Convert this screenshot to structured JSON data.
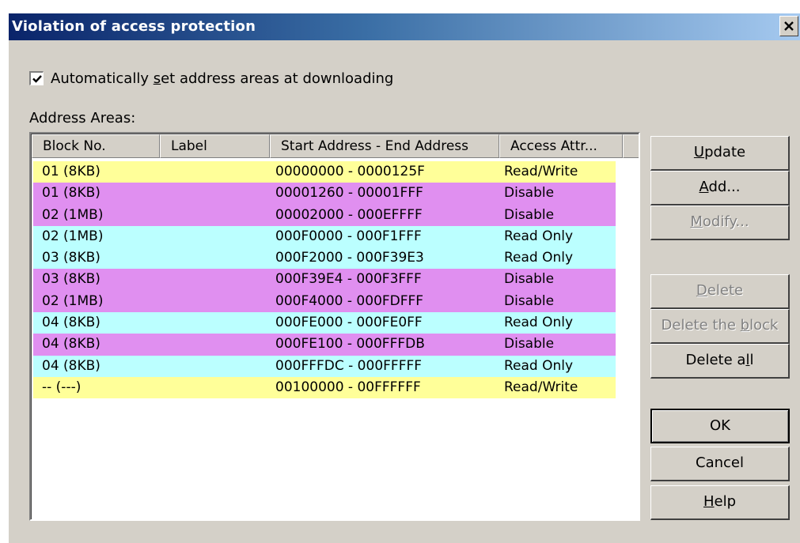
{
  "dialog": {
    "title": "Violation of access protection"
  },
  "auto_checkbox": {
    "checked": true,
    "label_pre": "Automatically ",
    "label_hot": "s",
    "label_post": "et address areas at downloading"
  },
  "section_label": "Address Areas:",
  "columns": [
    "Block No.",
    "Label",
    "Start Address - End Address",
    "Access Attr..."
  ],
  "colors": {
    "yellow": "#ffff99",
    "purple": "#e08ff0",
    "cyan": "#bbffff"
  },
  "rows": [
    {
      "block": "01 (8KB)",
      "label": "",
      "range": "00000000 - 0000125F",
      "access": "Read/Write",
      "color": "yellow"
    },
    {
      "block": "01 (8KB)",
      "label": "",
      "range": "00001260 - 00001FFF",
      "access": "Disable",
      "color": "purple"
    },
    {
      "block": "02 (1MB)",
      "label": "",
      "range": "00002000 - 000EFFFF",
      "access": "Disable",
      "color": "purple"
    },
    {
      "block": "02 (1MB)",
      "label": "",
      "range": "000F0000 - 000F1FFF",
      "access": "Read Only",
      "color": "cyan"
    },
    {
      "block": "03 (8KB)",
      "label": "",
      "range": "000F2000 - 000F39E3",
      "access": "Read Only",
      "color": "cyan"
    },
    {
      "block": "03 (8KB)",
      "label": "",
      "range": "000F39E4 - 000F3FFF",
      "access": "Disable",
      "color": "purple"
    },
    {
      "block": "02 (1MB)",
      "label": "",
      "range": "000F4000 - 000FDFFF",
      "access": "Disable",
      "color": "purple"
    },
    {
      "block": "04 (8KB)",
      "label": "",
      "range": "000FE000 - 000FE0FF",
      "access": "Read Only",
      "color": "cyan"
    },
    {
      "block": "04 (8KB)",
      "label": "",
      "range": "000FE100 - 000FFFDB",
      "access": "Disable",
      "color": "purple"
    },
    {
      "block": "04 (8KB)",
      "label": "",
      "range": "000FFFDC - 000FFFFF",
      "access": "Read Only",
      "color": "cyan"
    },
    {
      "block": "-- (---)",
      "label": "",
      "range": "00100000 - 00FFFFFF",
      "access": "Read/Write",
      "color": "yellow"
    }
  ],
  "buttons": {
    "update": {
      "hot": "U",
      "rest": "pdate",
      "enabled": true
    },
    "add": {
      "hot": "A",
      "rest": "dd...",
      "enabled": true
    },
    "modify": {
      "hot": "M",
      "rest": "odify...",
      "enabled": false
    },
    "delete": {
      "hot": "D",
      "rest": "elete",
      "enabled": false
    },
    "delete_block": {
      "pre": "Delete the ",
      "hot": "b",
      "rest": "lock",
      "enabled": false
    },
    "delete_all": {
      "pre": "Delete a",
      "hot": "l",
      "rest": "l",
      "enabled": true
    },
    "ok": {
      "label": "OK",
      "default": true
    },
    "cancel": {
      "label": "Cancel"
    },
    "help": {
      "hot": "H",
      "rest": "elp"
    }
  }
}
